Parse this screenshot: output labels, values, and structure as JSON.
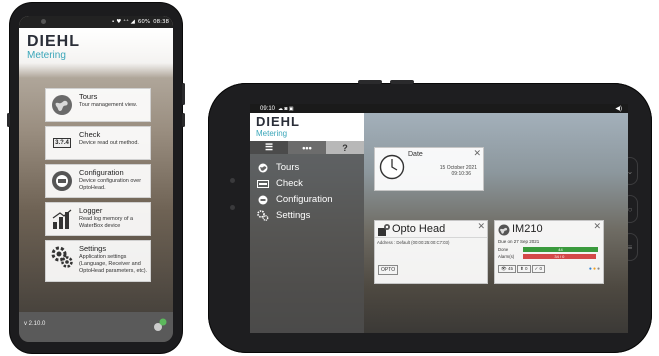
{
  "brand": {
    "name": "DIEHL",
    "subname": "Metering"
  },
  "phone": {
    "status": {
      "icons": "• ♥ ⁺⁺ ◢",
      "battery": "60%",
      "time": "08:38"
    },
    "menu": [
      {
        "icon": "tours-icon",
        "title": "Tours",
        "description": "Tour management view."
      },
      {
        "icon": "check-icon",
        "icon_text": "3.?.4",
        "title": "Check",
        "description": "Device read out method."
      },
      {
        "icon": "configuration-icon",
        "title": "Configuration",
        "description": "Device configuration over OptoHead."
      },
      {
        "icon": "logger-icon",
        "title": "Logger",
        "description": "Read log memory of a WaterBox device"
      },
      {
        "icon": "settings-icon",
        "title": "Settings",
        "description": "Application settings (Language, Receiver and OptoHead parameters, etc)."
      }
    ],
    "version": "v 2.10.0"
  },
  "tablet": {
    "status": {
      "time": "09:10"
    },
    "toolbar": {
      "menu": "☰",
      "more": "•••",
      "help": "?"
    },
    "nav": [
      {
        "icon": "tours-icon",
        "label": "Tours"
      },
      {
        "icon": "check-icon",
        "label": "Check"
      },
      {
        "icon": "configuration-icon",
        "label": "Configuration"
      },
      {
        "icon": "settings-icon",
        "label": "Settings"
      }
    ],
    "date_card": {
      "label": "Date",
      "date": "15 October 2021",
      "time": "09:10:36"
    },
    "opto_card": {
      "title": "Opto Head",
      "address": "Address : Default (00:00:25:00:C7:03)",
      "badge": "OPTO"
    },
    "im_card": {
      "title": "IM210",
      "due": "Due on 27 Sep 2021",
      "done": {
        "label": "Done",
        "value": "44",
        "fraction": 1.0
      },
      "alarms": {
        "label": "Alarm(s)",
        "value": "34 / 0",
        "fraction": 0.97
      },
      "chips": [
        "👁 45",
        "⬆ 0",
        "✓ 0"
      ]
    }
  }
}
